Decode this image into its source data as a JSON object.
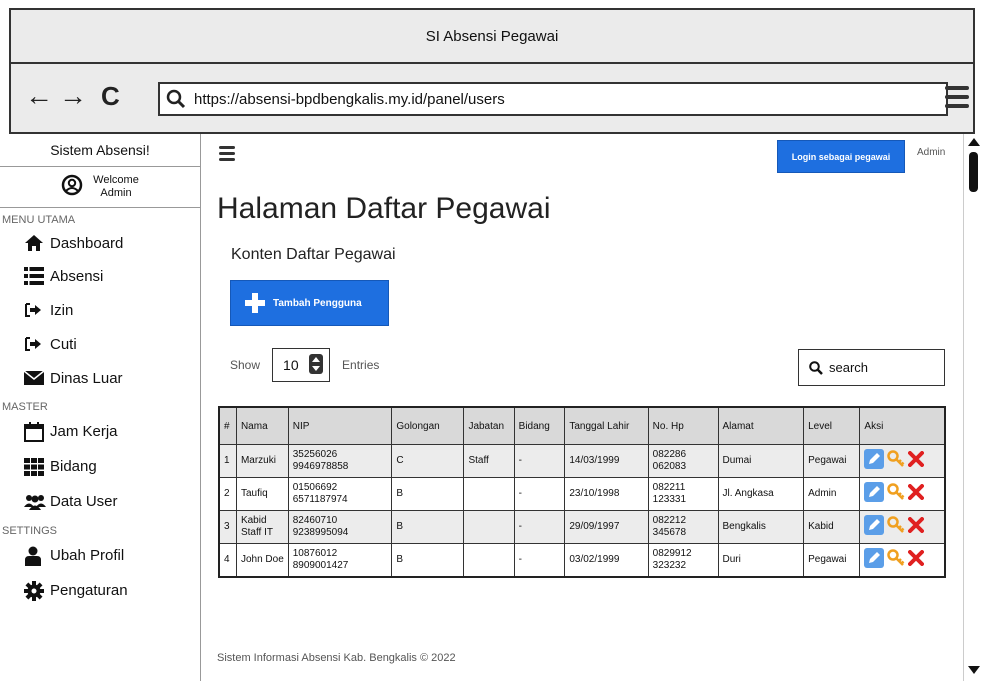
{
  "window": {
    "title": "SI Absensi Pegawai"
  },
  "browser": {
    "url": "https://absensi-bpdbengkalis.my.id/panel/users",
    "back": "←",
    "forward": "→",
    "reload": "C"
  },
  "sidebar": {
    "app_name": "Sistem Absensi!",
    "welcome_line1": "Welcome",
    "welcome_line2": "Admin",
    "sections": [
      {
        "title": "MENU UTAMA",
        "items": [
          {
            "label": "Dashboard",
            "icon": "home-icon"
          },
          {
            "label": "Absensi",
            "icon": "list-icon"
          },
          {
            "label": "Izin",
            "icon": "sign-in-icon"
          },
          {
            "label": "Cuti",
            "icon": "sign-in-icon"
          },
          {
            "label": "Dinas Luar",
            "icon": "envelope-icon"
          }
        ]
      },
      {
        "title": "MASTER",
        "items": [
          {
            "label": "Jam Kerja",
            "icon": "calendar-icon"
          },
          {
            "label": "Bidang",
            "icon": "grid-icon"
          },
          {
            "label": "Data User",
            "icon": "users-icon"
          }
        ]
      },
      {
        "title": "SETTINGS",
        "items": [
          {
            "label": "Ubah Profil",
            "icon": "user-icon"
          },
          {
            "label": "Pengaturan",
            "icon": "gear-icon"
          }
        ]
      }
    ]
  },
  "header": {
    "login_button": "Login sebagai pegawai",
    "user_label": "Admin"
  },
  "main": {
    "title": "Halaman Daftar Pegawai",
    "subtitle": "Konten Daftar Pegawai",
    "add_button": "Tambah Pengguna",
    "show_label": "Show",
    "entries_value": "10",
    "entries_label": "Entries",
    "search_placeholder": "search"
  },
  "table": {
    "headers": [
      "#",
      "Nama",
      "NIP",
      "Golongan",
      "Jabatan",
      "Bidang",
      "Tanggal Lahir",
      "No. Hp",
      "Alamat",
      "Level",
      "Aksi"
    ],
    "rows": [
      {
        "no": "1",
        "nama": "Marzuki",
        "nip": "35256026 9946978858",
        "golongan": "C",
        "jabatan": "Staff",
        "bidang": "-",
        "tgl": "14/03/1999",
        "hp": "082286 062083",
        "alamat": "Dumai",
        "level": "Pegawai"
      },
      {
        "no": "2",
        "nama": "Taufiq",
        "nip": "01506692 6571187974",
        "golongan": "B",
        "jabatan": "",
        "bidang": "-",
        "tgl": "23/10/1998",
        "hp": "082211 123331",
        "alamat": "Jl. Angkasa",
        "level": "Admin"
      },
      {
        "no": "3",
        "nama": "Kabid Staff IT",
        "nip": "82460710 9238995094",
        "golongan": "B",
        "jabatan": "",
        "bidang": "-",
        "tgl": "29/09/1997",
        "hp": "082212 345678",
        "alamat": "Bengkalis",
        "level": "Kabid"
      },
      {
        "no": "4",
        "nama": "John Doe",
        "nip": "10876012 8909001427",
        "golongan": "B",
        "jabatan": "",
        "bidang": "-",
        "tgl": "03/02/1999",
        "hp": "0829912 323232",
        "alamat": "Duri",
        "level": "Pegawai"
      }
    ]
  },
  "footer": {
    "text": "Sistem Informasi Absensi Kab. Bengkalis © 2022"
  },
  "colors": {
    "primary": "#1e6fe0",
    "danger": "#e02020",
    "key": "#f0a020",
    "edit": "#5b9ee8"
  }
}
